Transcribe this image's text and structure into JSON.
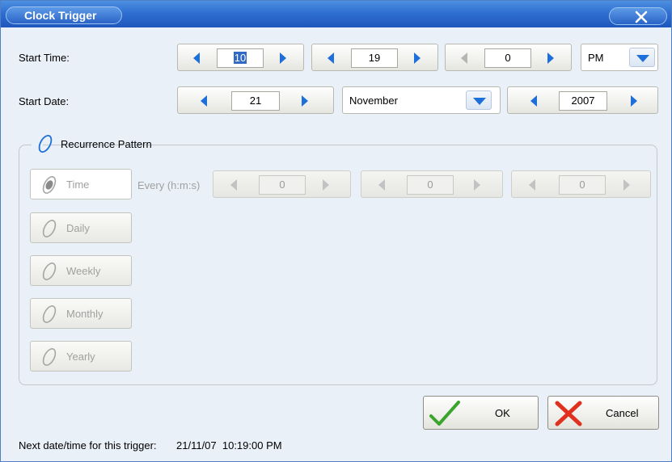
{
  "window": {
    "title": "Clock Trigger"
  },
  "start_time": {
    "label": "Start Time:",
    "hour": "10",
    "minute": "19",
    "second": "0",
    "ampm": "PM"
  },
  "start_date": {
    "label": "Start Date:",
    "day": "21",
    "month": "November",
    "year": "2007"
  },
  "recurrence": {
    "legend": "Recurrence Pattern",
    "options": [
      {
        "label": "Time"
      },
      {
        "label": "Daily"
      },
      {
        "label": "Weekly"
      },
      {
        "label": "Monthly"
      },
      {
        "label": "Yearly"
      }
    ],
    "every_label": "Every (h:m:s)",
    "hours": "0",
    "minutes": "0",
    "seconds": "0"
  },
  "buttons": {
    "ok": "OK",
    "cancel": "Cancel"
  },
  "footer": {
    "next_label": "Next date/time for this trigger:",
    "next_value": "21/11/07  10:19:00 PM"
  },
  "colors": {
    "accent": "#1e6fd9",
    "titlebar": "#2f6fd2",
    "ok_check": "#3aa52c",
    "cancel_x": "#e0301e"
  }
}
